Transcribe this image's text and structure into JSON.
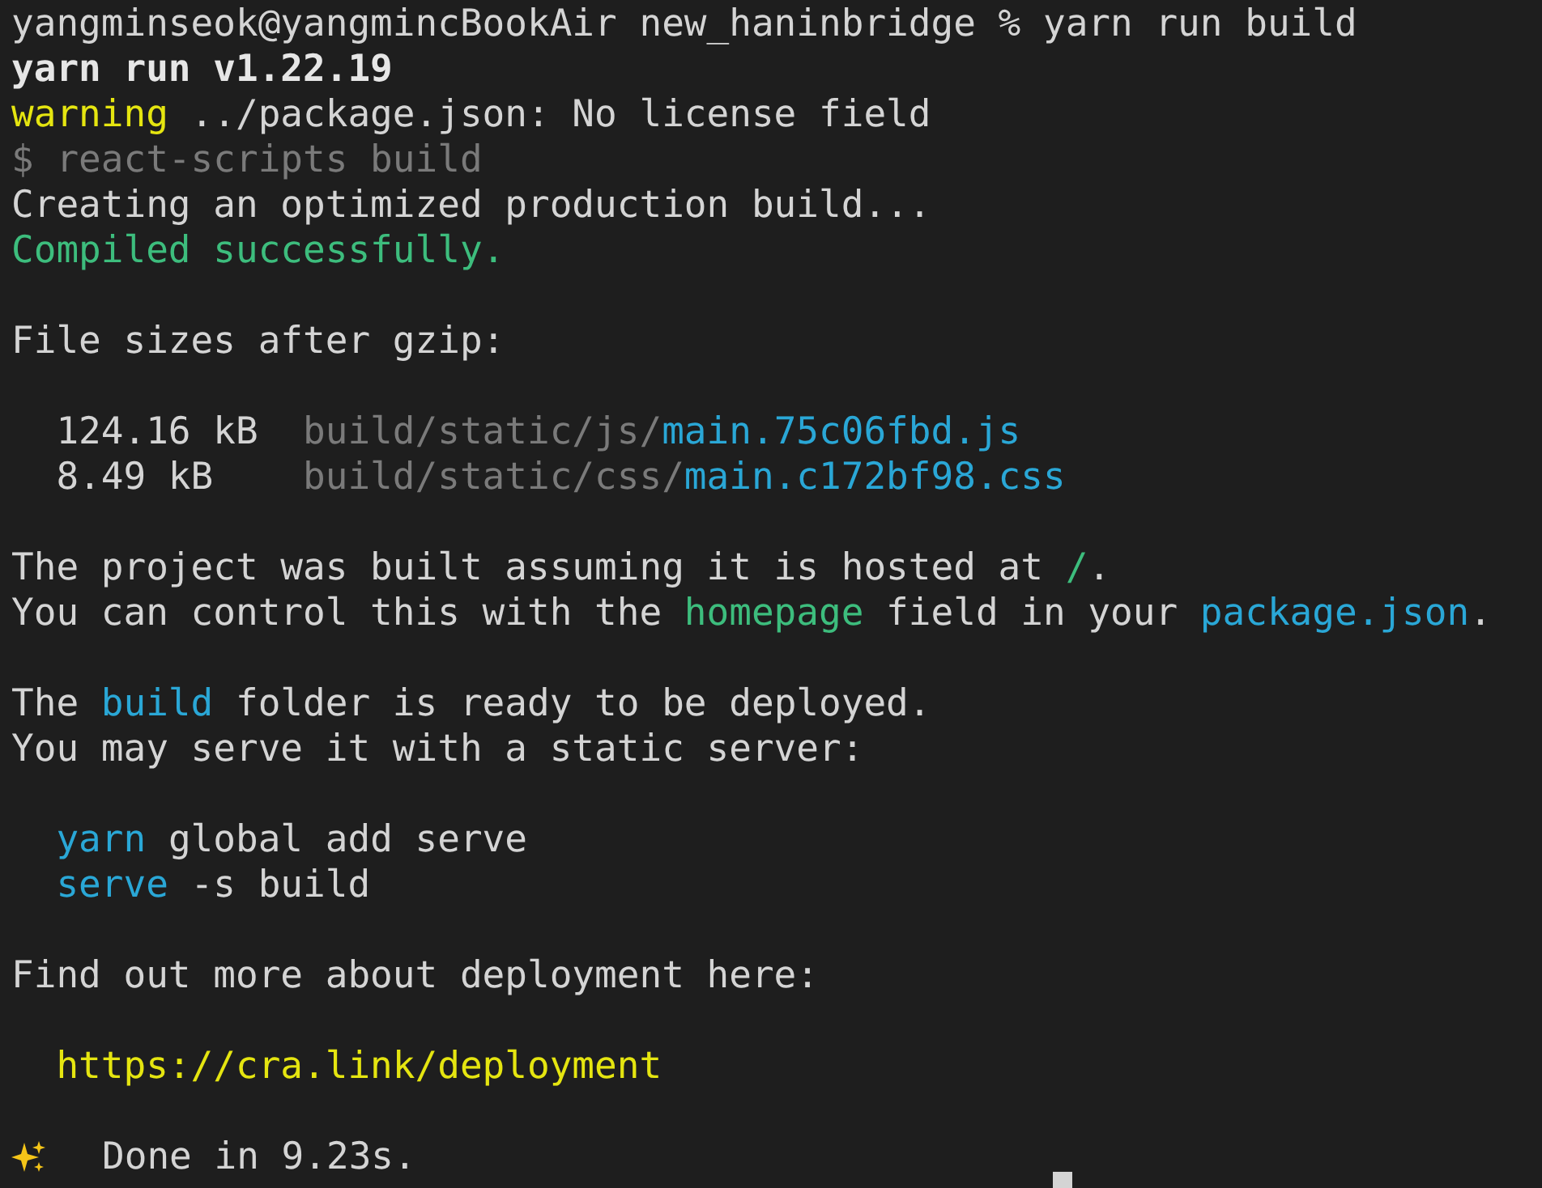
{
  "lines": [
    {
      "segments": [
        {
          "text": "yangminseok@yangmincBookAir new_haninbridge % yarn run build",
          "kind": "plain"
        }
      ]
    },
    {
      "segments": [
        {
          "text": "yarn run v1.22.19",
          "kind": "bold"
        }
      ]
    },
    {
      "segments": [
        {
          "text": "warning",
          "kind": "yellow"
        },
        {
          "text": " ../package.json: No license field",
          "kind": "plain"
        }
      ]
    },
    {
      "segments": [
        {
          "text": "$ react-scripts build",
          "kind": "dim"
        }
      ]
    },
    {
      "segments": [
        {
          "text": "Creating an optimized production build...",
          "kind": "plain"
        }
      ]
    },
    {
      "segments": [
        {
          "text": "Compiled successfully.",
          "kind": "green"
        }
      ]
    },
    {
      "kind": "blank"
    },
    {
      "segments": [
        {
          "text": "File sizes after gzip:",
          "kind": "plain"
        }
      ]
    },
    {
      "kind": "blank"
    },
    {
      "segments": [
        {
          "text": "  124.16 kB  ",
          "kind": "plain"
        },
        {
          "text": "build/static/js/",
          "kind": "dim"
        },
        {
          "text": "main.75c06fbd.js",
          "kind": "blue"
        }
      ]
    },
    {
      "segments": [
        {
          "text": "  8.49 kB    ",
          "kind": "plain"
        },
        {
          "text": "build/static/css/",
          "kind": "dim"
        },
        {
          "text": "main.c172bf98.css",
          "kind": "blue"
        }
      ]
    },
    {
      "kind": "blank"
    },
    {
      "segments": [
        {
          "text": "The project was built assuming it is hosted at ",
          "kind": "plain"
        },
        {
          "text": "/",
          "kind": "green"
        },
        {
          "text": ".",
          "kind": "plain"
        }
      ]
    },
    {
      "segments": [
        {
          "text": "You can control this with the ",
          "kind": "plain"
        },
        {
          "text": "homepage",
          "kind": "green"
        },
        {
          "text": " field in your ",
          "kind": "plain"
        },
        {
          "text": "package.json",
          "kind": "blue"
        },
        {
          "text": ".",
          "kind": "plain"
        }
      ]
    },
    {
      "kind": "blank"
    },
    {
      "segments": [
        {
          "text": "The ",
          "kind": "plain"
        },
        {
          "text": "build",
          "kind": "blue"
        },
        {
          "text": " folder is ready to be deployed.",
          "kind": "plain"
        }
      ]
    },
    {
      "segments": [
        {
          "text": "You may serve it with a static server:",
          "kind": "plain"
        }
      ]
    },
    {
      "kind": "blank"
    },
    {
      "segments": [
        {
          "text": "  yarn",
          "kind": "blue"
        },
        {
          "text": " global add serve",
          "kind": "plain"
        }
      ]
    },
    {
      "segments": [
        {
          "text": "  serve",
          "kind": "blue"
        },
        {
          "text": " -s build",
          "kind": "plain"
        }
      ]
    },
    {
      "kind": "blank"
    },
    {
      "segments": [
        {
          "text": "Find out more about deployment here:",
          "kind": "plain"
        }
      ]
    },
    {
      "kind": "blank"
    },
    {
      "segments": [
        {
          "text": "  https://cra.link/deployment",
          "kind": "yellow"
        }
      ]
    },
    {
      "kind": "blank"
    },
    {
      "kind": "done",
      "segments": [
        {
          "text": "Done in 9.23s.",
          "kind": "plain"
        }
      ]
    }
  ]
}
